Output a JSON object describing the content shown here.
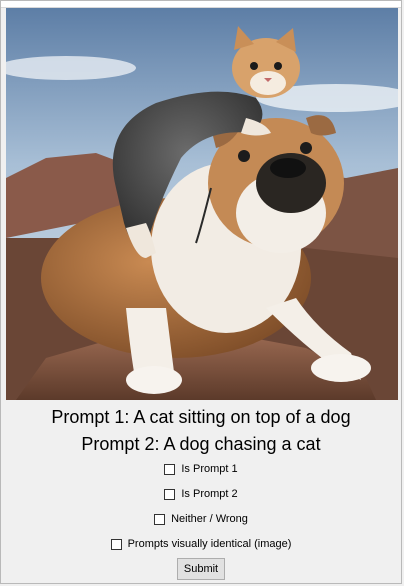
{
  "prompts": {
    "prompt_1": "Prompt 1: A cat sitting on top of a dog",
    "prompt_2": "Prompt 2: A dog chasing a cat"
  },
  "options": {
    "is_prompt_1": "Is Prompt 1",
    "is_prompt_2": "Is Prompt 2",
    "neither": "Neither / Wrong",
    "identical": "Prompts visually identical (image)"
  },
  "buttons": {
    "submit": "Submit"
  }
}
